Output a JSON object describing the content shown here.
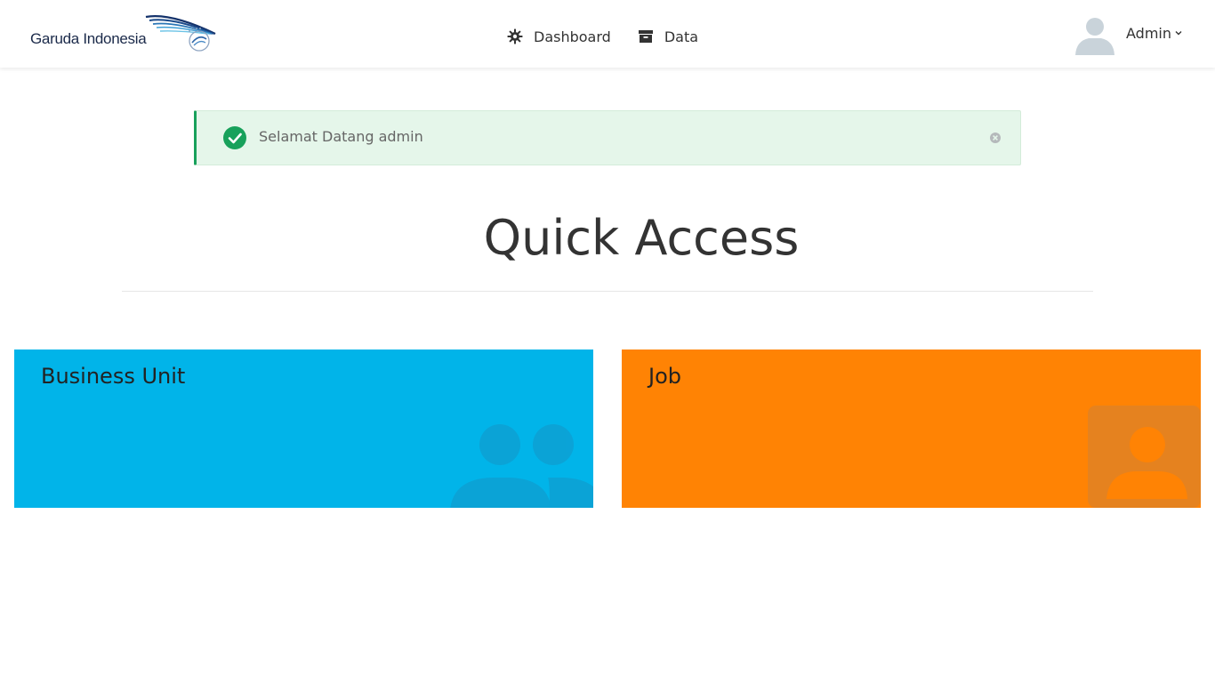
{
  "brand": {
    "name": "Garuda Indonesia",
    "logo_icon": "garuda-bird-logo"
  },
  "nav": {
    "items": [
      {
        "label": "Dashboard",
        "icon": "gear-icon"
      },
      {
        "label": "Data",
        "icon": "archive-box-icon"
      }
    ]
  },
  "user": {
    "name": "Admin",
    "avatar_icon": "user-silhouette",
    "caret_icon": "chevron-down-icon"
  },
  "alert": {
    "message": "Selamat Datang admin",
    "icon": "check-circle-icon",
    "close_icon": "close-circle-icon"
  },
  "page": {
    "title": "Quick Access"
  },
  "cards": [
    {
      "label": "Business Unit",
      "color": "#01b4e9",
      "icon": "users-icon"
    },
    {
      "label": "Job",
      "color": "#ff8304",
      "icon": "user-icon"
    }
  ],
  "colors": {
    "success_accent": "#18a15b",
    "alert_background": "#e5f6ea",
    "card_blue": "#01b4e9",
    "card_orange": "#ff8304"
  }
}
